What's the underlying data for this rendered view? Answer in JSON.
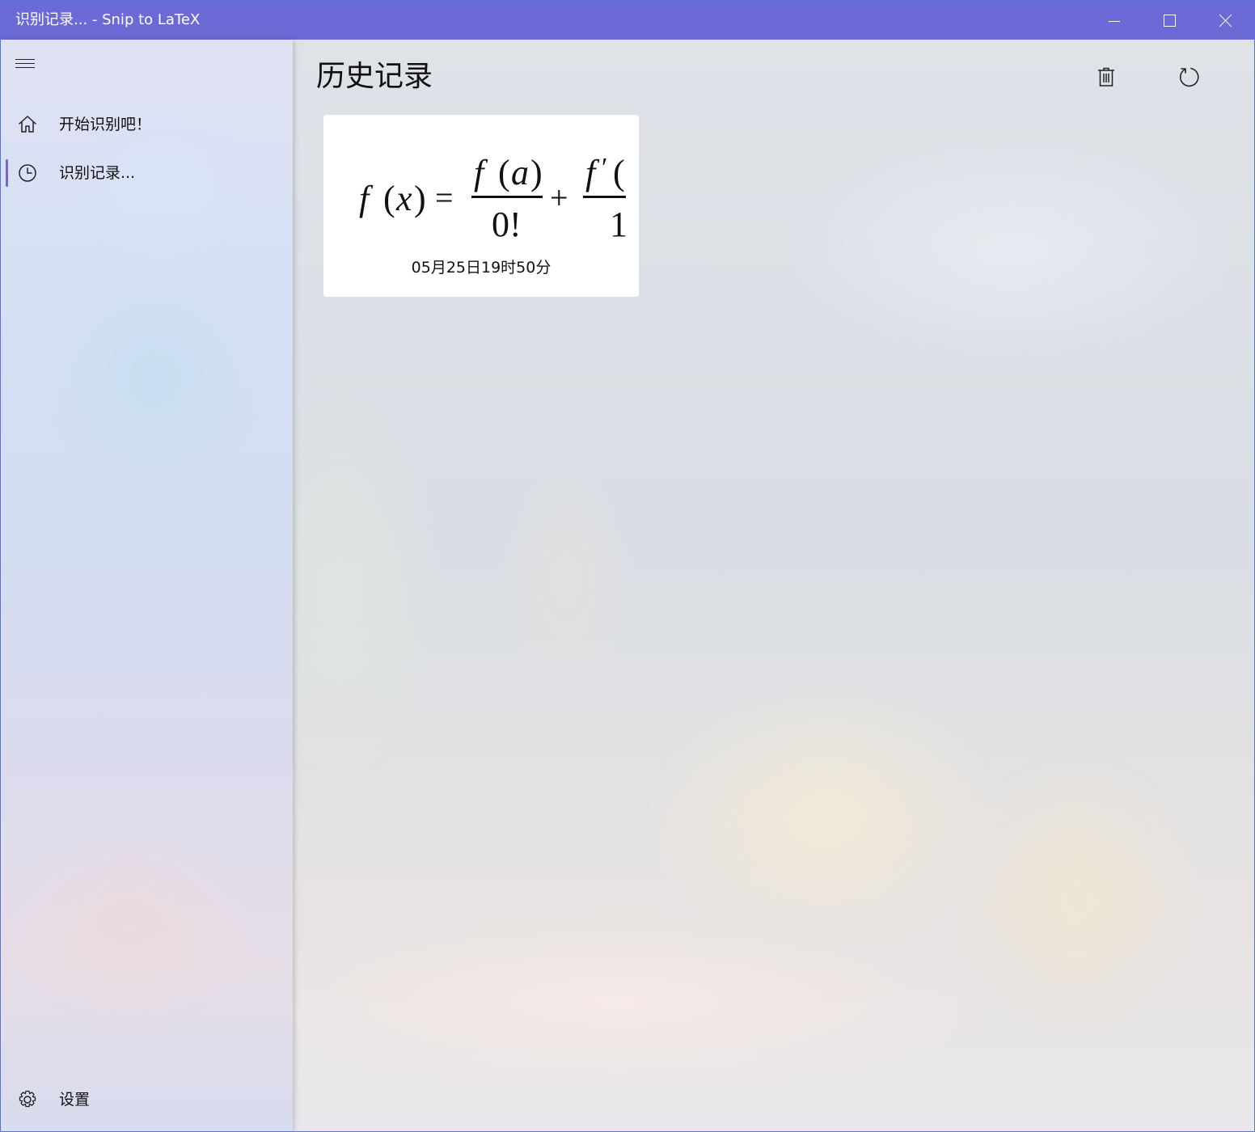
{
  "window": {
    "title": "识别记录... - Snip to LaTeX",
    "accent_color": "#6b6ad6"
  },
  "sidebar": {
    "items": [
      {
        "label": "开始识别吧！",
        "icon": "home-icon"
      },
      {
        "label": "识别记录...",
        "icon": "clock-icon",
        "selected": true
      }
    ],
    "footer": {
      "label": "设置",
      "icon": "gear-icon"
    }
  },
  "main": {
    "title": "历史记录",
    "toolbar": [
      {
        "icon": "delete-icon"
      },
      {
        "icon": "refresh-icon"
      }
    ],
    "history": [
      {
        "date": "05月25日19时50分",
        "formula_image": "f(x) = f(a)/0! + f'(...)/1"
      }
    ]
  }
}
